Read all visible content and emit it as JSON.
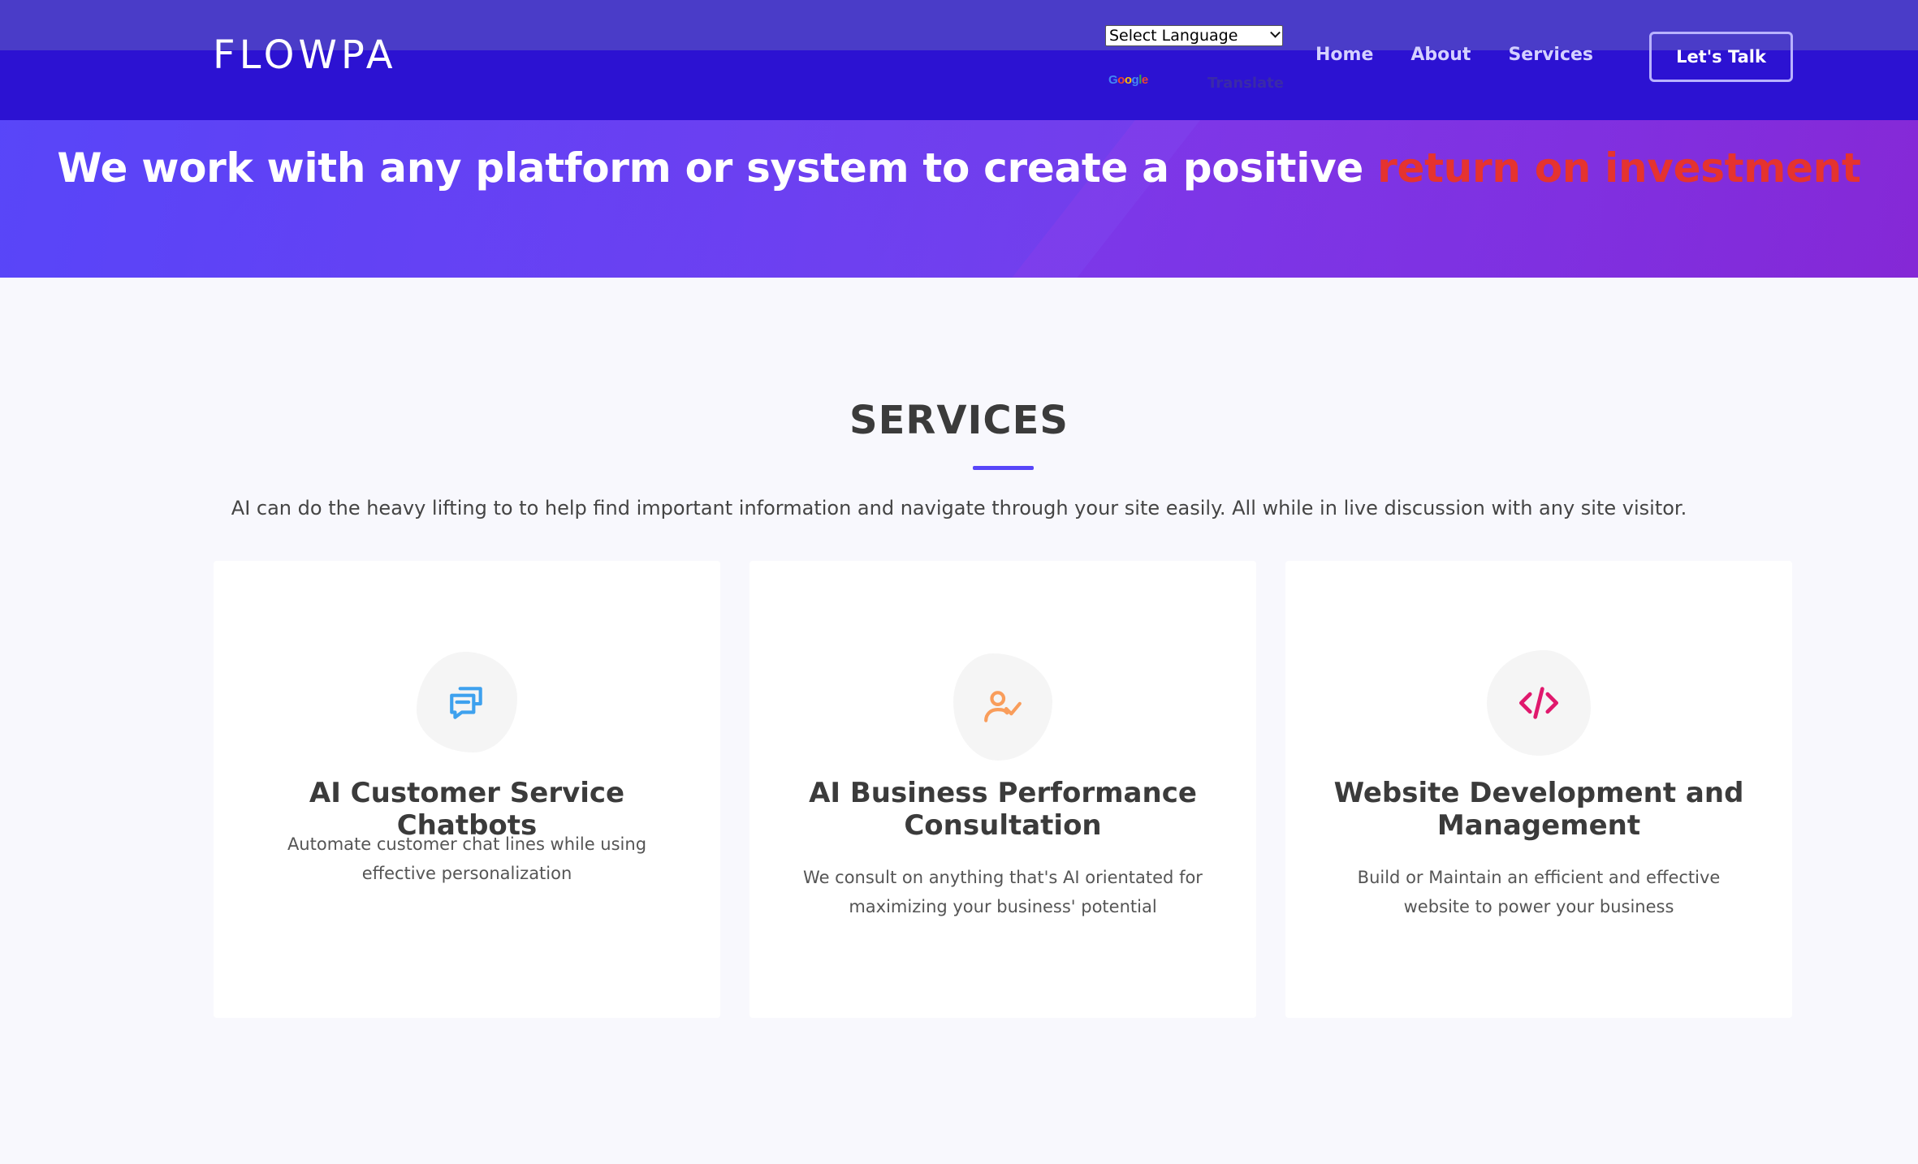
{
  "header": {
    "logo": "FLOWPA",
    "language_select": {
      "selected": "Select Language"
    },
    "google_brand": "Google",
    "translate_label": "Translate",
    "nav": [
      {
        "label": "Home"
      },
      {
        "label": "About"
      },
      {
        "label": "Services"
      }
    ],
    "cta_label": "Let's Talk"
  },
  "hero": {
    "headline_main": "We work with any platform or system to create a positive ",
    "headline_accent": "return on investment"
  },
  "services": {
    "title": "SERVICES",
    "subtitle": "AI can do the heavy lifting to to help find important information and navigate through your site easily. All while in live discussion with any site visitor.",
    "cards": [
      {
        "icon": "chat-bubbles-icon",
        "title": "AI Customer Service Chatbots",
        "description": "Automate customer chat lines while using effective personalization"
      },
      {
        "icon": "user-check-icon",
        "title": "AI Business Performance Consultation",
        "description": "We consult on anything that's AI orientated for maximizing your business' potential"
      },
      {
        "icon": "code-icon",
        "title": "Website Development and Management",
        "description": "Build or Maintain an efficient and effective website to power your business"
      }
    ]
  },
  "colors": {
    "brand_primary": "#5846f9",
    "navbar": "#2c12d2",
    "accent_red": "#e5332f",
    "icon_blue": "#3ea1ee",
    "icon_orange": "#f99d5b",
    "icon_pink": "#e0196d"
  }
}
